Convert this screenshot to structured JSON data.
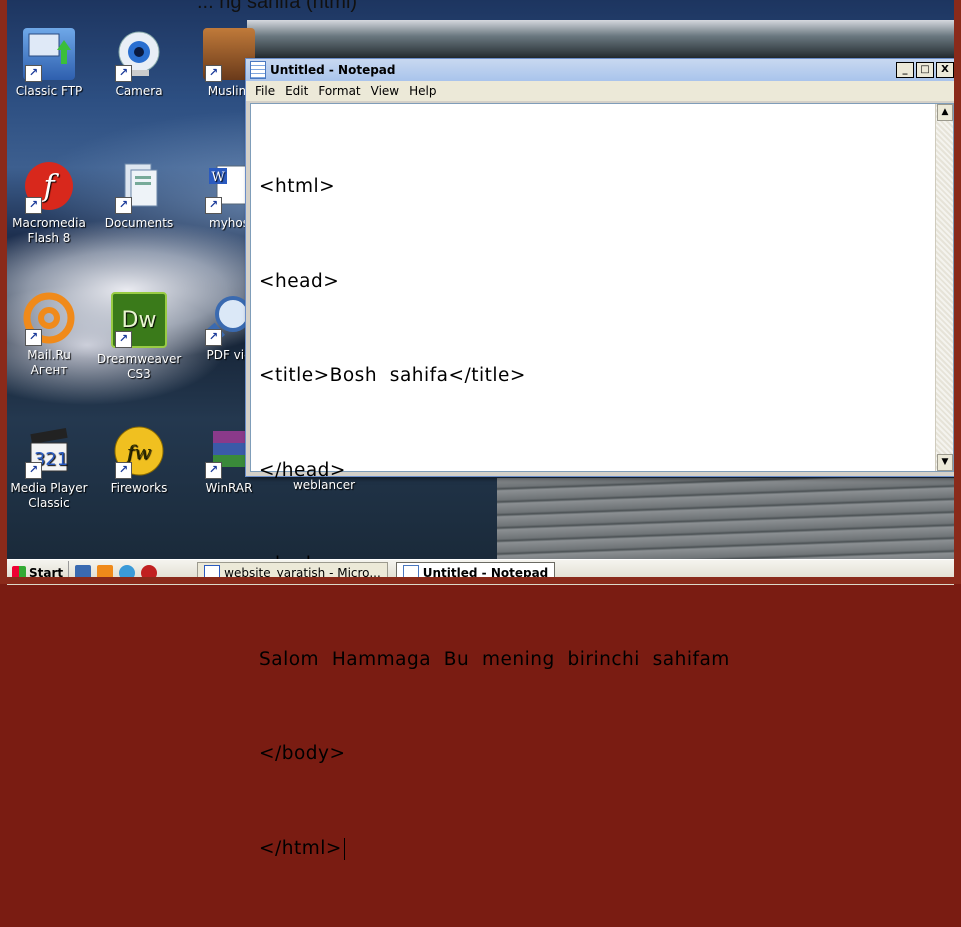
{
  "caption": "... ng sahifa (html)",
  "desktop_icons": [
    {
      "label": "Classic FTP",
      "icon": "ftp-icon"
    },
    {
      "label": "Camera",
      "icon": "camera-icon"
    },
    {
      "label": "Muslim",
      "icon": "muslim-icon"
    },
    {
      "label": "Macromedia Flash 8",
      "icon": "flash-icon"
    },
    {
      "label": "Documents",
      "icon": "documents-icon"
    },
    {
      "label": "myhos",
      "icon": "word-doc-icon"
    },
    {
      "label": "Mail.Ru Агент",
      "icon": "mailru-icon"
    },
    {
      "label": "Dreamweaver CS3",
      "icon": "dreamweaver-icon"
    },
    {
      "label": "PDF vie",
      "icon": "pdf-viewer-icon"
    },
    {
      "label": "Media Player Classic",
      "icon": "media-player-icon"
    },
    {
      "label": "Fireworks",
      "icon": "fireworks-icon"
    },
    {
      "label": "WinRAR",
      "icon": "winrar-icon"
    },
    {
      "label": "weblancer",
      "icon": "weblancer-icon"
    }
  ],
  "notepad": {
    "title": "Untitled - Notepad",
    "menu": [
      "File",
      "Edit",
      "Format",
      "View",
      "Help"
    ],
    "window_buttons": [
      "_",
      "□",
      "X"
    ],
    "lines": [
      "<html>",
      "<head>",
      "<title>Bosh  sahifa</title>",
      "</head>",
      "<body>",
      "Salom  Hammaga  Bu  mening  birinchi  sahifam",
      "</body>",
      "</html>"
    ]
  },
  "taskbar": {
    "start_label": "Start",
    "quick_launch": [
      "show-desktop-icon",
      "media-icon",
      "ie-icon",
      "opera-icon"
    ],
    "tasks": [
      {
        "label": "website_yaratish - Micro...",
        "active": false
      },
      {
        "label": "Untitled - Notepad",
        "active": true
      }
    ]
  },
  "colors": {
    "frame": "#8a2a1a",
    "titlebar": "#a9c4ec",
    "taskbar": "#ece9d8"
  }
}
